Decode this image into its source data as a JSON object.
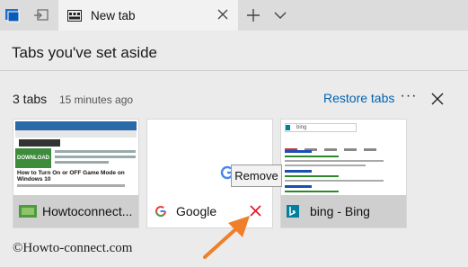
{
  "tabbar": {
    "active_tab_title": "New tab",
    "icons": [
      "tabs-aside-icon",
      "restore-aside-icon",
      "new-tab-plus-icon",
      "tab-list-chevron-icon"
    ]
  },
  "panel": {
    "title": "Tabs you've set aside",
    "group": {
      "count_label": "3 tabs",
      "time_label": "15 minutes ago",
      "restore_label": "Restore tabs",
      "more_label": "···"
    },
    "cards": [
      {
        "label": "Howtoconnect...",
        "thumb_banner": "DOWNLOAD",
        "thumb_headline": "How to Turn On or OFF Game Mode on Windows 10"
      },
      {
        "label": "Google"
      },
      {
        "label": "bing - Bing",
        "thumb_search": "bing"
      }
    ],
    "tooltip": "Remove"
  },
  "watermark": "©Howto-connect.com",
  "colors": {
    "accent_link": "#0063b1",
    "close_red": "#e81123",
    "arrow_orange": "#f07f2a",
    "tab_bar": "#dcdcdc",
    "panel_bg": "#ebebeb"
  }
}
